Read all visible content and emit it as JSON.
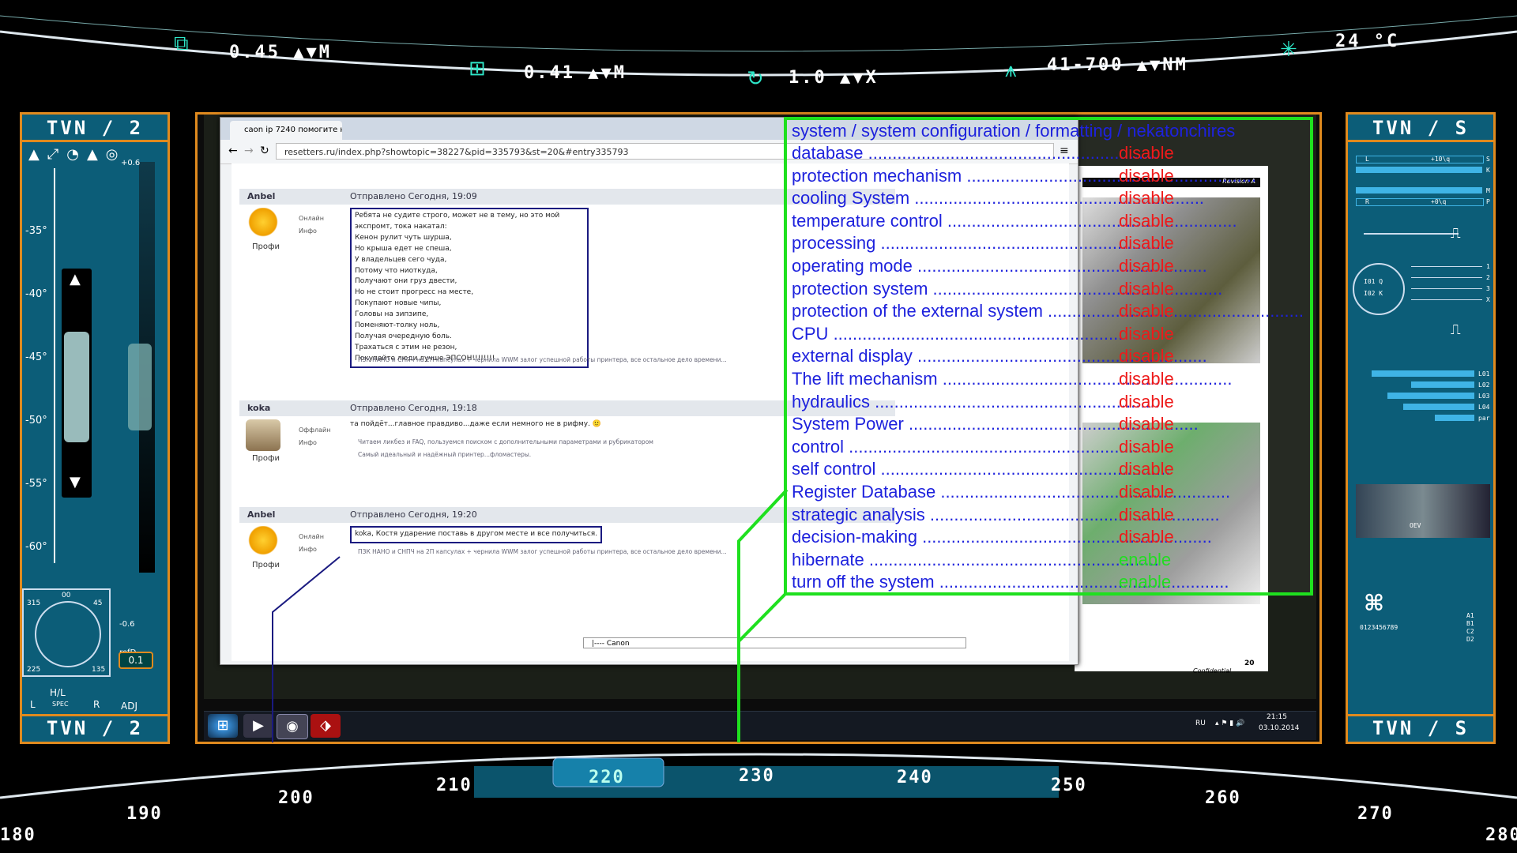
{
  "top_hud": {
    "readouts": [
      "0.45 ▲▼M",
      "0.41 ▲▼M",
      "1.0 ▲▼X",
      "41-700 ▲▼NM",
      "24 °C"
    ]
  },
  "left_panel": {
    "title_top": "TVN / 2",
    "title_bottom": "TVN / 2",
    "scale_values": [
      "+0.6",
      "-35°",
      "-40°",
      "-45°",
      "-50°",
      "-55°",
      "-60°",
      "-0.6",
      "refD"
    ],
    "compass": {
      "n": "00",
      "nw": "315",
      "ne": "45",
      "sw": "225",
      "se": "135"
    },
    "hl_label": "H/L",
    "spec_label": "SPEC",
    "l_label": "L",
    "r_label": "R",
    "adj_value": "0.1",
    "adj_label": "ADJ"
  },
  "right_panel": {
    "title_top": "TVN / S",
    "title_bottom": "TVN / S",
    "bars": [
      {
        "label": "L",
        "value_text": "+10\\q",
        "suffix": "S"
      },
      {
        "label": "R",
        "value_text": "",
        "suffix": "K"
      },
      {
        "label": "L",
        "value_text": "",
        "suffix": "M"
      },
      {
        "label": "R",
        "value_text": "+0\\q",
        "suffix": "P"
      }
    ],
    "dial_labels": [
      "I01 Q",
      "I02 K"
    ],
    "slider_labels": [
      "1",
      "2",
      "3",
      "X"
    ],
    "level_labels": [
      "L01",
      "L02",
      "L03",
      "L04",
      "par"
    ],
    "cam_label": "OEV",
    "digit_label": "0123456789",
    "chip_labels": [
      "A1",
      "B1",
      "C2",
      "D2"
    ]
  },
  "browser": {
    "tab_title": "caon ip 7240 помогите н",
    "url": "resetters.ru/index.php?showtopic=38227&pid=335793&st=20&#entry335793"
  },
  "posts": [
    {
      "author": "Anbel",
      "date": "Отправлено Сегодня, 19:09",
      "role": "Профи",
      "status": [
        "Онлайн",
        "Инфо"
      ],
      "lines": [
        "Ребята не судите строго, может не в тему, но это мой экспромт, тока накатал:",
        "Кенон рулит чуть шурша,",
        "Но крыша едет не спеша,",
        "У владельцев сего чуда,",
        "Потому что ниоткуда,",
        "Получают они груз двести,",
        "Но не стоит прогресс на месте,",
        "Покупают новые чипы,",
        "Головы на зипзипе,",
        "Поменяют-толку ноль,",
        "Получая очередную боль.",
        "Трахаться с этим не резон,",
        "Покупайте люди лучше ЭПСОН!!!!!!!!"
      ],
      "signature": "ПЗК НАНО и СНПЧ на 2П капсулах + чернила WWM залог успешной работы принтера, все остальное дело времени..."
    },
    {
      "author": "koka",
      "date": "Отправлено Сегодня, 19:18",
      "role": "Профи",
      "status": [
        "Оффлайн",
        "Инфо"
      ],
      "lines": [
        "та пойдёт...главное правдиво...даже если немного не в рифму. 🙂"
      ],
      "signature": "Читаем ликбез и FAQ, пользуемся поиском с дополнительными параметрами и рубрикатором",
      "signature2": "Самый идеальный и надёжный принтер...фломастеры."
    },
    {
      "author": "Anbel",
      "date": "Отправлено Сегодня, 19:20",
      "role": "Профи",
      "status": [
        "Онлайн",
        "Инфо"
      ],
      "lines": [
        "koka, Костя ударение поставь в другом месте и все получиться."
      ],
      "signature": "ПЗК НАНО и СНПЧ на 2П капсулах + чернила WWM залог успешной работы принтера, все остальное дело времени..."
    }
  ],
  "canon_select": "|---- Canon",
  "doc": {
    "header": "Revision A",
    "footer_page": "20",
    "footer_label": "Confidential"
  },
  "status_panel": {
    "heading": "system / system configuration / formatting / nekatonchires",
    "items": [
      {
        "label": "database",
        "value": "disable"
      },
      {
        "label": "protection mechanism",
        "value": "disable"
      },
      {
        "label": "cooling System",
        "value": "disable"
      },
      {
        "label": "temperature control",
        "value": "disable"
      },
      {
        "label": "processing",
        "value": "disable"
      },
      {
        "label": "operating mode",
        "value": "disable"
      },
      {
        "label": "protection system",
        "value": "disable"
      },
      {
        "label": "protection of the external system",
        "value": "disable"
      },
      {
        "label": "CPU",
        "value": "disable"
      },
      {
        "label": "external display",
        "value": "disable"
      },
      {
        "label": "The lift mechanism",
        "value": "disable"
      },
      {
        "label": "hydraulics",
        "value": "disable"
      },
      {
        "label": "System Power",
        "value": "disable"
      },
      {
        "label": "control",
        "value": "disable"
      },
      {
        "label": "self control",
        "value": "disable"
      },
      {
        "label": "Register Database",
        "value": "disable"
      },
      {
        "label": "strategic analysis",
        "value": "disable"
      },
      {
        "label": "decision-making",
        "value": "disable"
      },
      {
        "label": "hibernate",
        "value": "enable"
      },
      {
        "label": "turn off the system",
        "value": "enable"
      }
    ]
  },
  "taskbar": {
    "lang": "RU",
    "time": "21:15",
    "date": "03.10.2014"
  },
  "bottom_hud": {
    "scale": [
      "180",
      "190",
      "200",
      "210",
      "220",
      "230",
      "240",
      "250",
      "260",
      "270",
      "280"
    ]
  },
  "colors": {
    "panel_bg": "#0c5d78",
    "frame_orange": "#e08a1e",
    "status_green": "#1fe01f",
    "label_blue": "#1e22dd",
    "disable_red": "#ee1a1a",
    "enable_green": "#22dd22"
  }
}
